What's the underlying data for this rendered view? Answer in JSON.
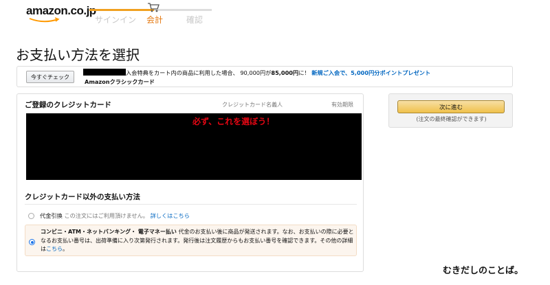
{
  "header": {
    "logo_text": "amazon.co.jp",
    "steps": [
      {
        "label": "サインイン",
        "state": "done"
      },
      {
        "label": "会計",
        "state": "current"
      },
      {
        "label": "確認",
        "state": "upcoming"
      }
    ],
    "accent_color": "#e47911"
  },
  "page_title": "お支払い方法を選択",
  "promo": {
    "check_button": "今すぐチェック",
    "line1_text": "入会特典をカート内の商品に利用した場合、 90,000円が",
    "line1_amount": "85,000円",
    "line1_suffix": "に！",
    "line1_link": "新規ご入会で、5,000円分ポイントプレゼント",
    "card_name": "Amazonクラシックカード"
  },
  "payment": {
    "registered_heading": "ご登録のクレジットカード",
    "col_cardholder": "クレジットカード名義人",
    "col_expiry": "有効期限",
    "other_heading": "クレジットカード以外の支払い方法",
    "cod": {
      "label": "代金引換",
      "note": "この注文にはご利用頂けません。",
      "link": "詳しくはこちら",
      "selected": false
    },
    "konbini": {
      "label": "コンビニ・ATM・ネットバンキング・ 電子マネー払い",
      "description": "代金のお支払い後に商品が発送されます。なお、お支払いの際に必要となるお支払い番号は、出荷準備に入り次第発行されます。発行後は注文履歴からもお支払い番号を確認できます。その他の詳細は",
      "link": "こちら",
      "end": "。",
      "selected": true
    }
  },
  "annotation": "必ず、これを選ぼう！",
  "sidebar": {
    "next_button": "次に進む",
    "note": "(注文の最終確認ができます)"
  },
  "watermark": "むきだしのことば。"
}
